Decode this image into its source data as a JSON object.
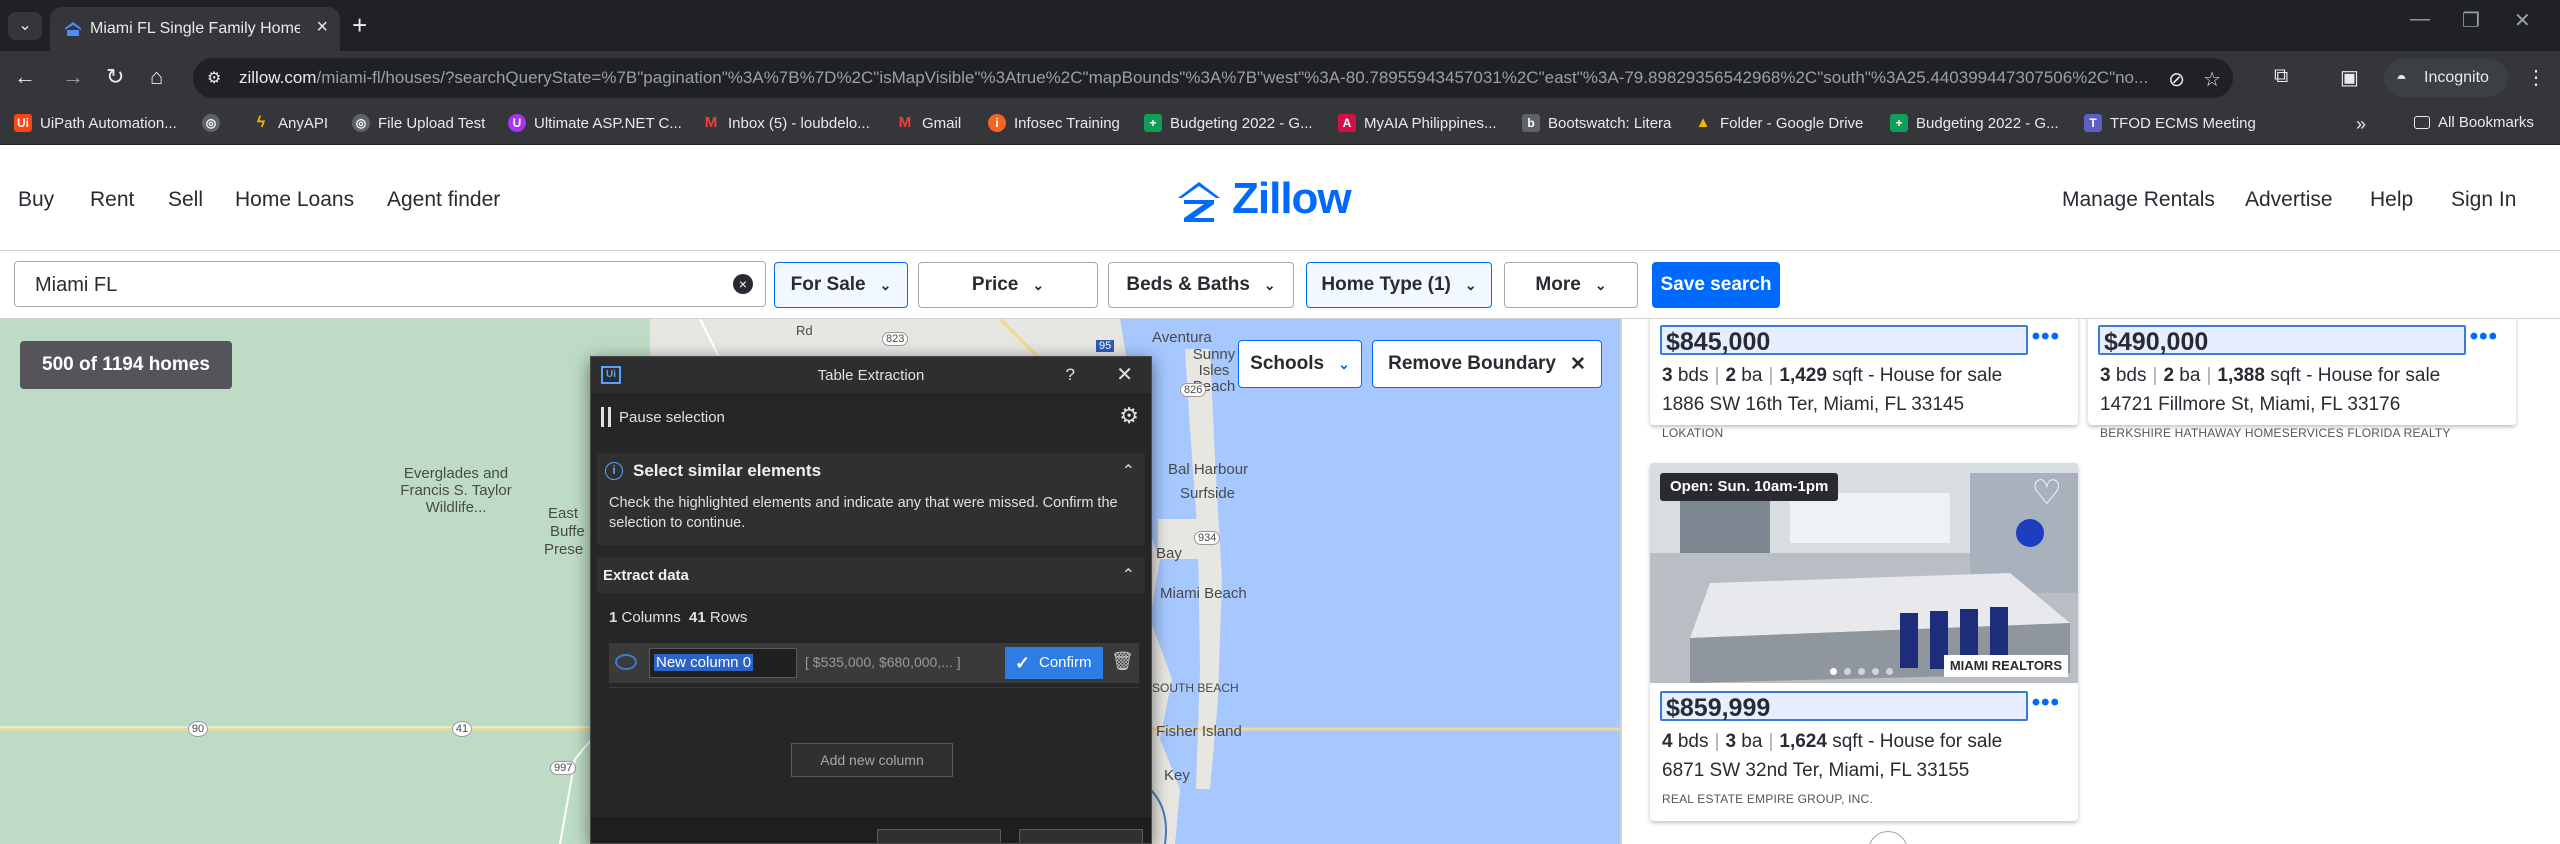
{
  "browser": {
    "tab_title": "Miami FL Single Family Homes",
    "url_host": "zillow.com",
    "url_rest": "/miami-fl/houses/?searchQueryState=%7B\"pagination\"%3A%7B%7D%2C\"isMapVisible\"%3Atrue%2C\"mapBounds\"%3A%7B\"west\"%3A-80.78955943457031%2C\"east\"%3A-79.89829356542968%2C\"south\"%3A25.440399447307506%2C\"no...",
    "incognito_label": "Incognito",
    "bookmarks": [
      {
        "label": "UiPath Automation...",
        "icon": "uipath-icon",
        "color": "#fa4616"
      },
      {
        "label": "",
        "icon": "globe-icon",
        "color": "#5f6368"
      },
      {
        "label": "AnyAPI",
        "icon": "bolt-icon",
        "color": "#f4b400"
      },
      {
        "label": "File Upload Test",
        "icon": "globe-icon",
        "color": "#5f6368"
      },
      {
        "label": "Ultimate ASP.NET C...",
        "icon": "udemy-icon",
        "color": "#a435f0"
      },
      {
        "label": "Inbox (5) - loubdelo...",
        "icon": "gmail-icon",
        "color": "#ea4335"
      },
      {
        "label": "Gmail",
        "icon": "gmail-icon",
        "color": "#ea4335"
      },
      {
        "label": "Infosec Training",
        "icon": "infosec-icon",
        "color": "#f26522"
      },
      {
        "label": "Budgeting 2022 - G...",
        "icon": "sheets-icon",
        "color": "#0f9d58"
      },
      {
        "label": "MyAIA Philippines...",
        "icon": "aia-icon",
        "color": "#d31145"
      },
      {
        "label": "Bootswatch: Litera",
        "icon": "bootswatch-icon",
        "color": "#5f6368"
      },
      {
        "label": "Folder - Google Drive",
        "icon": "drive-icon",
        "color": "#f4b400"
      },
      {
        "label": "Budgeting 2022 - G...",
        "icon": "sheets-icon",
        "color": "#0f9d58"
      },
      {
        "label": "TFOD ECMS Meeting",
        "icon": "teams-icon",
        "color": "#5b5fc7"
      }
    ],
    "all_bookmarks": "All Bookmarks"
  },
  "zillow": {
    "nav_left": [
      "Buy",
      "Rent",
      "Sell",
      "Home Loans",
      "Agent finder"
    ],
    "nav_right": [
      "Manage Rentals",
      "Advertise",
      "Help",
      "Sign In"
    ],
    "logo_text": "Zillow",
    "brand_color": "#006aff"
  },
  "filters": {
    "search_value": "Miami FL",
    "for_sale": "For Sale",
    "price": "Price",
    "beds_baths": "Beds & Baths",
    "home_type": "Home Type (1)",
    "more": "More",
    "save_search": "Save search"
  },
  "map": {
    "home_count": "500 of 1194 homes",
    "schools": "Schools",
    "remove_boundary": "Remove Boundary",
    "labels": {
      "everglades": "Everglades and Francis S. Taylor Wildlife...",
      "aventura": "Aventura",
      "sunny_isles": "Sunny Isles Beach",
      "bal_harbour": "Bal Harbour",
      "surfside": "Surfside",
      "bay": "Bay",
      "miami_beach": "Miami Beach",
      "south_beach": "SOUTH BEACH",
      "fisher_island": "Fisher Island",
      "key": "Key",
      "east": "East",
      "buffe": "Buffe",
      "prese": "Prese",
      "rd": "Rd",
      "r823": "823",
      "r95": "95",
      "r826": "826",
      "r934": "934",
      "r90": "90",
      "r41": "41",
      "r997": "997"
    }
  },
  "listings": [
    {
      "price": "$845,000",
      "beds": "3",
      "beds_label": "bds",
      "baths": "2",
      "baths_label": "ba",
      "sqft": "1,429",
      "sqft_label": "sqft",
      "type": "House for sale",
      "address": "1886 SW 16th Ter, Miami, FL 33145",
      "broker": "LOKATION"
    },
    {
      "price": "$490,000",
      "beds": "3",
      "beds_label": "bds",
      "baths": "2",
      "baths_label": "ba",
      "sqft": "1,388",
      "sqft_label": "sqft",
      "type": "House for sale",
      "address": "14721 Fillmore St, Miami, FL 33176",
      "broker": "BERKSHIRE HATHAWAY HOMESERVICES FLORIDA REALTY"
    },
    {
      "open_house": "Open: Sun. 10am-1pm",
      "realtor_logo": "MIAMI REALTORS",
      "price": "$859,999",
      "beds": "4",
      "beds_label": "bds",
      "baths": "3",
      "baths_label": "ba",
      "sqft": "1,624",
      "sqft_label": "sqft",
      "type": "House for sale",
      "address": "6871 SW 32nd Ter, Miami, FL 33155",
      "broker": "REAL ESTATE EMPIRE GROUP, INC."
    }
  ],
  "uipath": {
    "title": "Table Extraction",
    "help": "?",
    "pause": "Pause selection",
    "select_heading": "Select similar elements",
    "select_text": "Check the highlighted elements and indicate any that were missed. Confirm the selection to continue.",
    "extract_heading": "Extract data",
    "columns_count": "1",
    "columns_label": "Columns",
    "rows_count": "41",
    "rows_label": "Rows",
    "column_name": "New column 0",
    "preview": "[ $535,000, $680,000,... ]",
    "confirm": "Confirm",
    "add_column": "Add new column"
  }
}
